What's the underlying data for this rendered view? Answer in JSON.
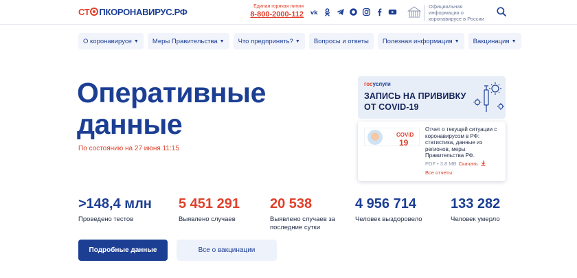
{
  "header": {
    "logo_part1": "СТ",
    "logo_part2": "ПКОРОНАВИРУС.РФ",
    "hotline_caption": "Единая горячая линия",
    "hotline_number": "8-800-2000-112",
    "social_icons": [
      "vk-icon",
      "ok-icon",
      "telegram-icon",
      "viber-icon",
      "instagram-icon",
      "facebook-icon",
      "youtube-icon"
    ],
    "gov_text": "Официальная информация о коронавирусе в России"
  },
  "nav": {
    "items": [
      {
        "label": "О коронавирусе",
        "has_caret": true
      },
      {
        "label": "Меры Правительства",
        "has_caret": true
      },
      {
        "label": "Что предпринять?",
        "has_caret": true
      },
      {
        "label": "Вопросы и ответы",
        "has_caret": false
      },
      {
        "label": "Полезная информация",
        "has_caret": true
      },
      {
        "label": "Вакцинация",
        "has_caret": true
      }
    ]
  },
  "hero": {
    "title_line1": "Оперативные",
    "title_line2": "данные",
    "as_of": "По состоянию на 27 июня 11:15"
  },
  "promo": {
    "brand_a": "гос",
    "brand_b": "услуги",
    "headline_line1": "ЗАПИСЬ НА ПРИВИВКУ",
    "headline_line2": "ОТ COVID-19"
  },
  "report": {
    "thumb_label": "COVID",
    "thumb_number": "19",
    "description": "Отчет о текущей ситуации с коронавирусом в РФ: статистика, данные из регионов, меры Правительства РФ.",
    "format": "PDF • 3.8 MB",
    "download_label": "Скачать",
    "all_reports_label": "Все отчеты"
  },
  "stats": [
    {
      "value": ">148,4 млн",
      "label": "Проведено тестов",
      "color": "#1c3f94"
    },
    {
      "value": "5 451 291",
      "label": "Выявлено случаев",
      "color": "#e0402a"
    },
    {
      "value": "20 538",
      "label": "Выявлено случаев за последние сутки",
      "color": "#e0402a"
    },
    {
      "value": "4 956 714",
      "label": "Человек выздоровело",
      "color": "#1c3f94"
    },
    {
      "value": "133 282",
      "label": "Человек умерло",
      "color": "#1c3f94"
    }
  ],
  "buttons": {
    "details": "Подробные данные",
    "vaccination": "Все о вакцинации"
  },
  "colors": {
    "brand_blue": "#1c3f94",
    "accent_red": "#e0402a",
    "nav_bg": "#f1f4fb"
  }
}
